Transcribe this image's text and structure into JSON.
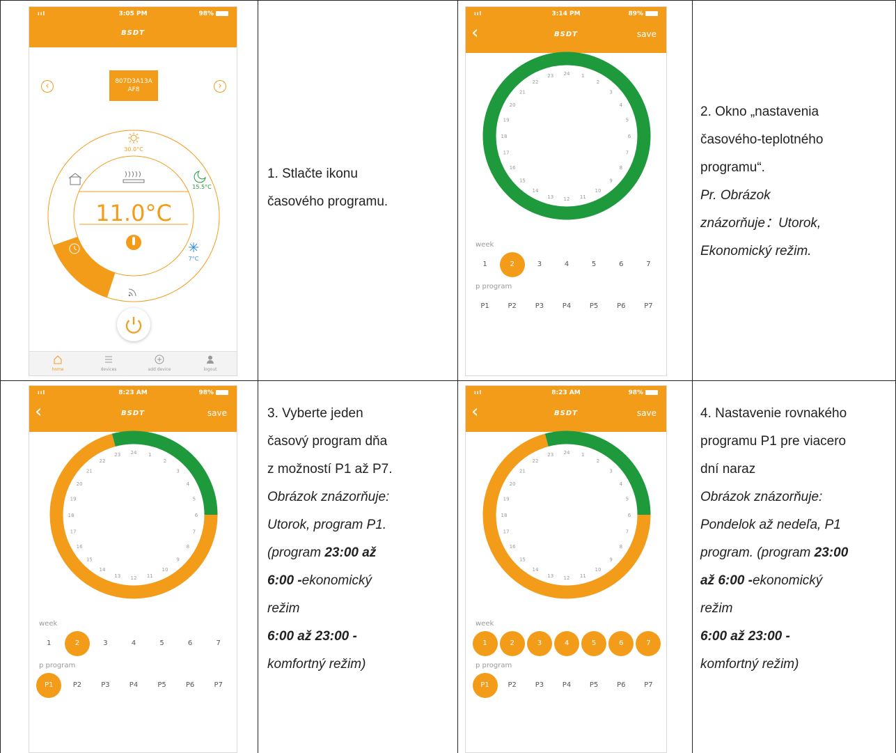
{
  "phone1": {
    "status": {
      "signal": "ııl",
      "time": "3:05 PM",
      "battery": "98%"
    },
    "logo": "BSDT",
    "device_id_line1": "807D3A13A",
    "device_id_line2": "AF8",
    "left_arrow": "‹",
    "right_arrow": "›",
    "sun_temp": "30.0°C",
    "moon_temp": "15.5°C",
    "snow_temp": "7°C",
    "current_temp": "11.0°C",
    "nav": [
      {
        "label": "home",
        "icon": "home-icon"
      },
      {
        "label": "devices",
        "icon": "list-icon"
      },
      {
        "label": "add device",
        "icon": "add-icon"
      },
      {
        "label": "logout",
        "icon": "user-icon"
      }
    ]
  },
  "phone2": {
    "status": {
      "signal": "ııl",
      "time": "3:14 PM",
      "battery": "89%"
    },
    "logo": "BSDT",
    "save": "save",
    "week_label": "week",
    "days": [
      "1",
      "2",
      "3",
      "4",
      "5",
      "6",
      "7"
    ],
    "selected_days": [
      "2"
    ],
    "program_label": "p program",
    "programs": [
      "P1",
      "P2",
      "P3",
      "P4",
      "P5",
      "P6",
      "P7"
    ],
    "selected_program": "",
    "ring": {
      "eco_from": 0,
      "eco_to": 24
    }
  },
  "phone3": {
    "status": {
      "signal": "ııl",
      "time": "8:23 AM",
      "battery": "98%"
    },
    "logo": "BSDT",
    "save": "save",
    "week_label": "week",
    "days": [
      "1",
      "2",
      "3",
      "4",
      "5",
      "6",
      "7"
    ],
    "selected_days": [
      "2"
    ],
    "program_label": "p program",
    "programs": [
      "P1",
      "P2",
      "P3",
      "P4",
      "P5",
      "P6",
      "P7"
    ],
    "selected_program": "P1",
    "ring": {
      "eco_from": 23,
      "eco_to": 6
    }
  },
  "phone4": {
    "status": {
      "signal": "ııl",
      "time": "8:23 AM",
      "battery": "98%"
    },
    "logo": "BSDT",
    "save": "save",
    "week_label": "week",
    "days": [
      "1",
      "2",
      "3",
      "4",
      "5",
      "6",
      "7"
    ],
    "selected_days": [
      "1",
      "2",
      "3",
      "4",
      "5",
      "6",
      "7"
    ],
    "program_label": "p program",
    "programs": [
      "P1",
      "P2",
      "P3",
      "P4",
      "P5",
      "P6",
      "P7"
    ],
    "selected_program": "P1",
    "ring": {
      "eco_from": 23,
      "eco_to": 6
    }
  },
  "colors": {
    "orange": "#f39c1a",
    "green": "#1e9a3c"
  },
  "cells": {
    "c1": {
      "l1": "1. Stlačte ikonu",
      "l2": "časového programu."
    },
    "c2": {
      "l1": "2. Okno „nastavenia",
      "l2": "časového-teplotného",
      "l3": "programu“.",
      "l4": "Pr. Obrázok",
      "l5": "znázorňuje：Utorok,",
      "l6": "Ekonomický režim."
    },
    "c3": {
      "l1": "3. Vyberte jeden",
      "l2": "časový program dňa",
      "l3": "z možností P1 až P7.",
      "l4": "Obrázok znázorňuje:",
      "l5": "Utorok, program P1.",
      "l6a": "(program ",
      "l6b": "23:00 až",
      "l7a": "6:00 -",
      "l7b": "ekonomický",
      "l8": "režim",
      "l9": "6:00 až 23:00 -",
      "l10": "komfortný režim)"
    },
    "c4": {
      "l1": "4. Nastavenie rovnakého",
      "l2": "programu P1 pre viacero",
      "l3": "dní naraz",
      "l4": "Obrázok znázorňuje:",
      "l5": "Pondelok až nedeľa, P1",
      "l6a": "program. (program ",
      "l6b": "23:00",
      "l7a": "až 6:00 -",
      "l7b": "ekonomický",
      "l8": "režim",
      "l9": "6:00 až 23:00 -",
      "l10": "komfortný režim)"
    }
  }
}
